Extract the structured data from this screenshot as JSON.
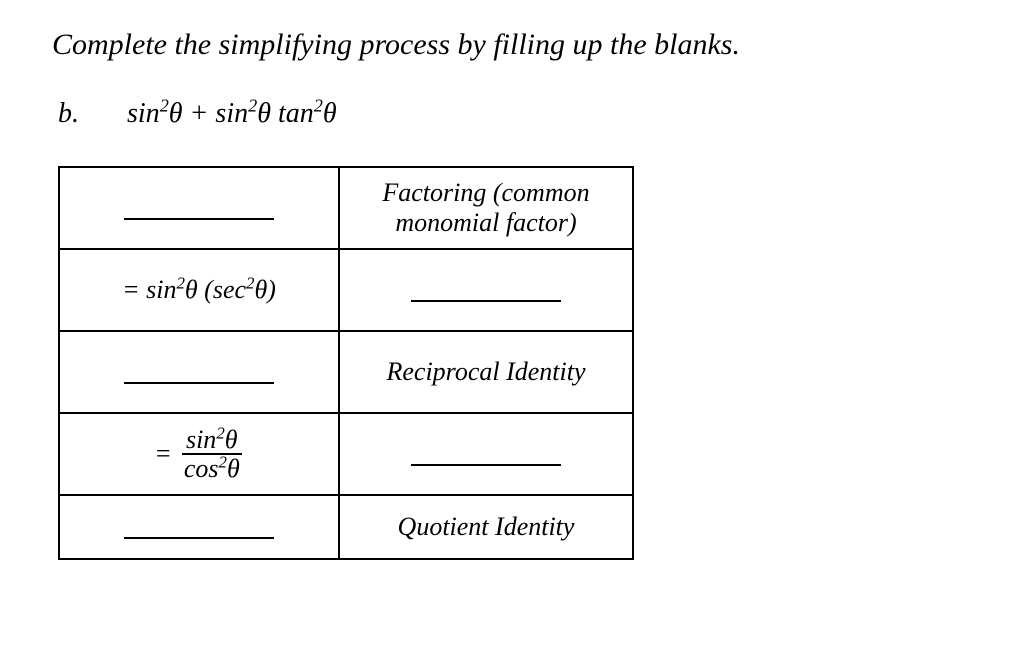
{
  "instruction": "Complete the simplifying process by filling up the blanks.",
  "item_label": "b.",
  "expression": {
    "p1": "sin",
    "p2": "θ + sin",
    "p3": "θ tan",
    "p4": "θ"
  },
  "rows": [
    {
      "reason_top": "Factoring (common",
      "reason_bottom": "monomial factor)"
    },
    {
      "step_prefix": "= sin",
      "step_mid": "θ (sec",
      "step_suffix": "θ)"
    },
    {
      "reason": "Reciprocal Identity"
    },
    {
      "eq": "=",
      "num_a": "sin",
      "num_b": "θ",
      "den_a": "cos",
      "den_b": "θ"
    },
    {
      "reason": "Quotient Identity"
    }
  ]
}
